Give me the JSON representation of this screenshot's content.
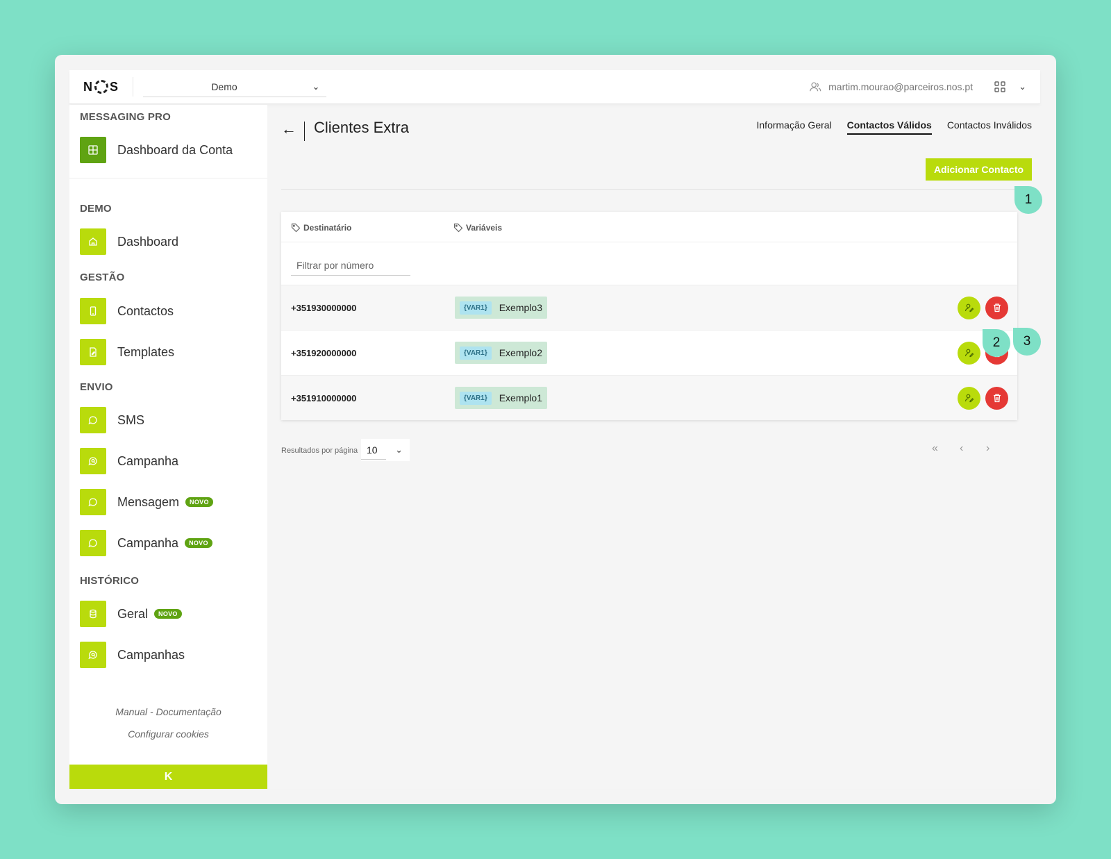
{
  "header": {
    "logo": "NOS",
    "account": "Demo",
    "user_email": "martim.mourao@parceiros.nos.pt"
  },
  "sidebar": {
    "section_messaging": "MESSAGING PRO",
    "account_dashboard": "Dashboard da Conta",
    "section_demo": "DEMO",
    "dashboard": "Dashboard",
    "section_gestao": "GESTÃO",
    "contactos": "Contactos",
    "templates": "Templates",
    "section_envio": "ENVIO",
    "sms": "SMS",
    "campanha": "Campanha",
    "mensagem": "Mensagem",
    "mensagem_badge": "NOVO",
    "campanha2": "Campanha",
    "campanha2_badge": "NOVO",
    "section_historico": "HISTÓRICO",
    "geral": "Geral",
    "geral_badge": "NOVO",
    "campanhas": "Campanhas",
    "manual_link": "Manual - Documentação",
    "cookies_link": "Configurar cookies",
    "collapse_label": "K"
  },
  "main": {
    "title": "Clientes Extra",
    "tabs": [
      "Informação Geral",
      "Contactos Válidos",
      "Contactos Inválidos"
    ],
    "add_button": "Adicionar Contacto",
    "columns": {
      "recipient": "Destinatário",
      "variables": "Variáveis"
    },
    "filter_placeholder": "Filtrar por número",
    "rows": [
      {
        "number": "+351930000000",
        "var_key": "{VAR1}",
        "var_value": "Exemplo3"
      },
      {
        "number": "+351920000000",
        "var_key": "{VAR1}",
        "var_value": "Exemplo2"
      },
      {
        "number": "+351910000000",
        "var_key": "{VAR1}",
        "var_value": "Exemplo1"
      }
    ],
    "pagination": {
      "label": "Resultados por página",
      "page_size": "10"
    }
  },
  "callouts": [
    "1",
    "2",
    "3"
  ],
  "colors": {
    "accent": "#b9db0c",
    "dark_green": "#5fa312",
    "danger": "#e53935",
    "callout": "#7ee0c6"
  }
}
